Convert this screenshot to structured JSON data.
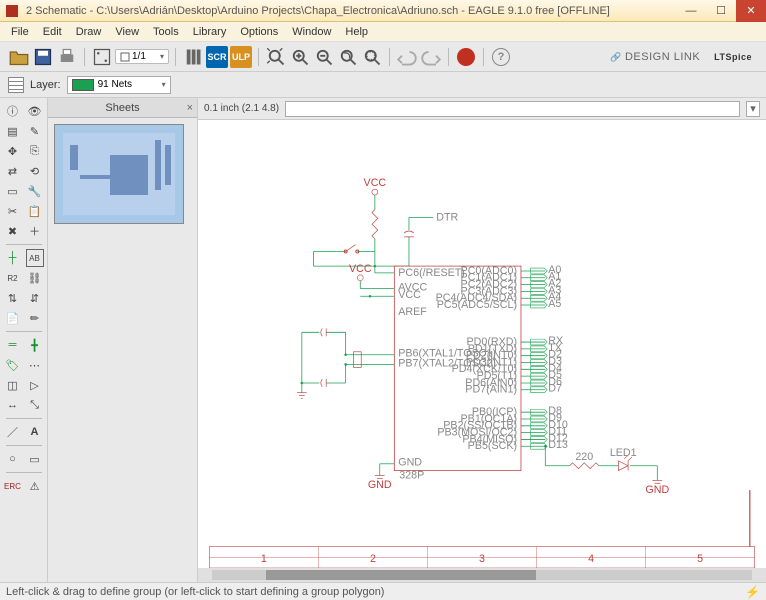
{
  "window": {
    "title": "2 Schematic - C:\\Users\\Adrián\\Desktop\\Arduino Projects\\Chapa_Electronica\\Adriuno.sch - EAGLE 9.1.0 free [OFFLINE]"
  },
  "menu": {
    "file": "File",
    "edit": "Edit",
    "draw": "Draw",
    "view": "View",
    "tools": "Tools",
    "library": "Library",
    "options": "Options",
    "window": "Window",
    "help": "Help"
  },
  "toolbar": {
    "ratio": "1/1",
    "scr": "SCR",
    "ulp": "ULP",
    "design_link": "DESIGN LINK",
    "ltspice": "LTSpice"
  },
  "layerbar": {
    "label": "Layer:",
    "value": "91 Nets"
  },
  "sheets": {
    "title": "Sheets",
    "close": "×"
  },
  "coord": {
    "text": "0.1 inch (2.1 4.8)"
  },
  "command": {
    "value": ""
  },
  "status": {
    "text": "Left-click & drag to define group (or left-click to start defining a group polygon)"
  },
  "ruler": {
    "n1": "1",
    "n2": "2",
    "n3": "3",
    "n4": "4",
    "n5": "5"
  },
  "schematic": {
    "vcc": "VCC",
    "dtr": "DTR",
    "gnd": "GND",
    "gndr": "GND",
    "aref": "AREF",
    "chip": "328P",
    "p_reset": "PC6(/RESET)",
    "p_avcc": "AVCC",
    "p_vcc": "VCC",
    "p_xtal1": "PB6(XTAL1/TOSC1)",
    "p_xtal2": "PB7(XTAL2/TOSC2)",
    "pc0": "PC0(ADC0)",
    "pc1": "PC1(ADC1)",
    "pc2": "PC2(ADC2)",
    "pc3": "PC3(ADC3)",
    "pc4": "PC4(ADC4/SDA)",
    "pc5": "PC5(ADC5/SCL)",
    "pd0": "PD0(RXD)",
    "pd1": "PD1(TXD)",
    "pd2": "PD2(INT0)",
    "pd3": "PD3(INT1)",
    "pd4": "PD4(XCK/T0)",
    "pd5": "PD5(T1)",
    "pd6": "PD6(AIN0)",
    "pd7": "PD7(AIN1)",
    "pb0": "PB0(ICP)",
    "pb1": "PB1(OC1A)",
    "pb2": "PB2(SS/OC1B)",
    "pb3": "PB3(MOSI/OC2)",
    "pb4": "PB4(MISO)",
    "pb5": "PB5(SCK)",
    "p_gnd": "GND",
    "a0": "A0",
    "a1": "A1",
    "a2": "A2",
    "a3": "A3",
    "a4": "A4",
    "a5": "A5",
    "rx": "RX",
    "tx": "TX",
    "d2": "D2",
    "d3": "D3",
    "d4": "D4",
    "d5": "D5",
    "d6": "D6",
    "d7": "D7",
    "d8": "D8",
    "d9": "D9",
    "d10": "D10",
    "d11": "D11",
    "d12": "D12",
    "d13": "D13",
    "r_220": "220",
    "led": "LED1"
  }
}
